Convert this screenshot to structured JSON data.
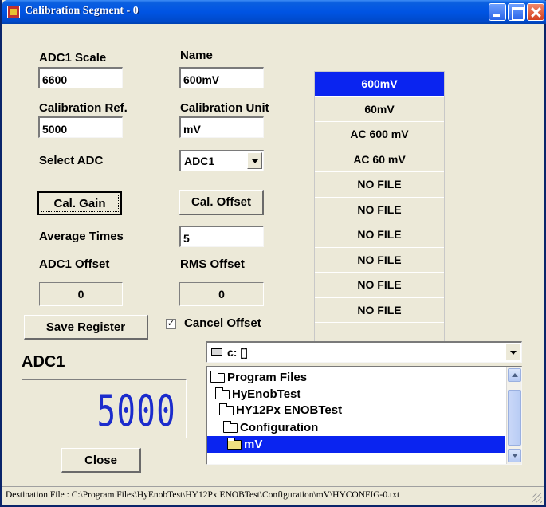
{
  "window": {
    "title": "Calibration Segment - 0"
  },
  "fields": {
    "adc_scale_label": "ADC1 Scale",
    "adc_scale_value": "6600",
    "name_label": "Name",
    "name_value": "600mV",
    "cal_ref_label": "Calibration Ref.",
    "cal_ref_value": "5000",
    "cal_unit_label": "Calibration Unit",
    "cal_unit_value": "mV",
    "select_adc_label": "Select  ADC",
    "select_adc_value": "ADC1",
    "average_times_label": "Average Times",
    "average_times_value": "5",
    "adc_offset_label": "ADC1 Offset",
    "adc_offset_value": "0",
    "rms_offset_label": "RMS Offset",
    "rms_offset_value": "0"
  },
  "buttons": {
    "cal_gain": "Cal. Gain",
    "cal_offset": "Cal. Offset",
    "save_register": "Save Register",
    "close": "Close"
  },
  "cancel_offset": {
    "label": "Cancel Offset",
    "checked": true,
    "mark": "✓"
  },
  "segments": {
    "items": [
      "600mV",
      "60mV",
      "AC 600 mV",
      "AC 60 mV",
      "NO FILE",
      "NO FILE",
      "NO FILE",
      "NO FILE",
      "NO FILE",
      "NO FILE"
    ],
    "selected_index": 0
  },
  "display": {
    "title": "ADC1",
    "value": "5000"
  },
  "drive": {
    "value": "c: []"
  },
  "directories": [
    "Program Files",
    "HyEnobTest",
    "HY12Px ENOBTest",
    "Configuration",
    "mV"
  ],
  "selected_directory": "mV",
  "status": {
    "text": "Destination File : C:\\Program Files\\HyEnobTest\\HY12Px ENOBTest\\Configuration\\mV\\HYCONFIG-0.txt"
  },
  "colors": {
    "selection": "#0a24f0",
    "lcd_digits": "#1c2ccc",
    "titlebar": "#0054e3"
  }
}
